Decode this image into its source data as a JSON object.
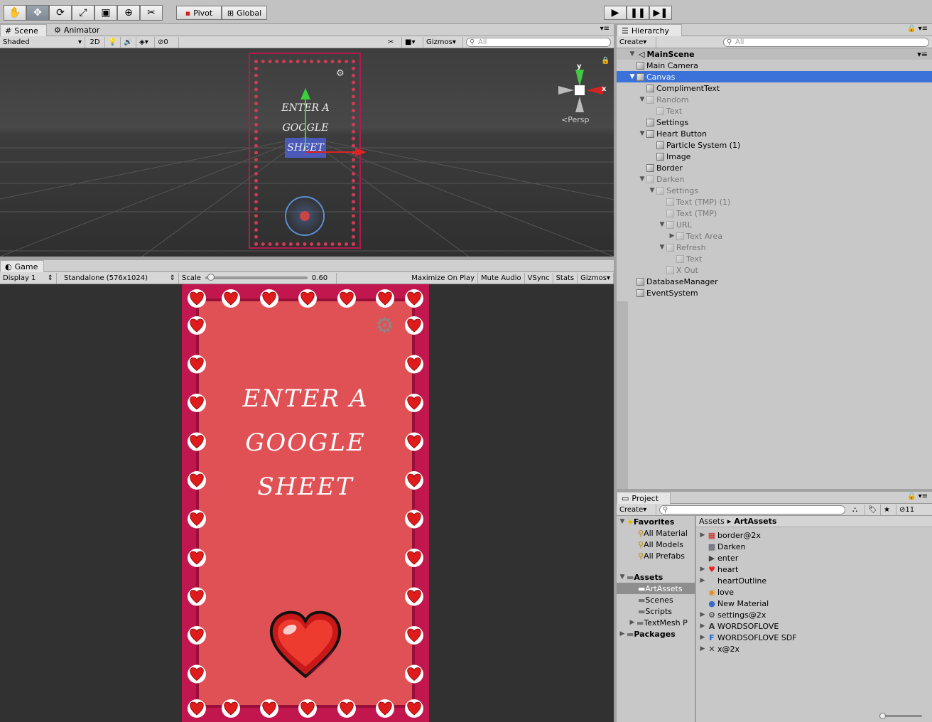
{
  "toolbar": {
    "tools": [
      "hand-tool-icon",
      "move-tool-icon",
      "rotate-tool-icon",
      "scale-tool-icon",
      "rect-tool-icon",
      "transform-tool-icon",
      "custom-tool-icon"
    ],
    "pivot": "Pivot",
    "global": "Global"
  },
  "scene": {
    "tab": "Scene",
    "animator_tab": "Animator",
    "shading": "Shaded",
    "mode_2d": "2D",
    "fx_count": "0",
    "gizmos": "Gizmos",
    "search_placeholder": "All",
    "persp": "Persp",
    "axis_y": "y",
    "axis_x": "x"
  },
  "game": {
    "tab": "Game",
    "display": "Display 1",
    "resolution": "Standalone (576x1024)",
    "scale_label": "Scale",
    "scale_value": "0.60",
    "scale_fraction": 0.02,
    "toggles": [
      "Maximize On Play",
      "Mute Audio",
      "VSync",
      "Stats",
      "Gizmos"
    ],
    "title_lines": [
      "ENTER A",
      "GOOGLE",
      "SHEET"
    ],
    "bg_color": "#df5155",
    "border_color": "#c1174e"
  },
  "hierarchy": {
    "tab": "Hierarchy",
    "create": "Create",
    "search_placeholder": "All",
    "scene": "MainScene",
    "items": [
      {
        "label": "Main Camera",
        "depth": 1,
        "arrow": "",
        "dim": false,
        "sel": false
      },
      {
        "label": "Canvas",
        "depth": 1,
        "arrow": "down",
        "dim": false,
        "sel": true
      },
      {
        "label": "ComplimentText",
        "depth": 2,
        "arrow": "",
        "dim": false,
        "sel": false
      },
      {
        "label": "Random",
        "depth": 2,
        "arrow": "down",
        "dim": true,
        "sel": false
      },
      {
        "label": "Text",
        "depth": 3,
        "arrow": "",
        "dim": true,
        "sel": false
      },
      {
        "label": "Settings",
        "depth": 2,
        "arrow": "",
        "dim": false,
        "sel": false
      },
      {
        "label": "Heart Button",
        "depth": 2,
        "arrow": "down",
        "dim": false,
        "sel": false
      },
      {
        "label": "Particle System (1)",
        "depth": 3,
        "arrow": "",
        "dim": false,
        "sel": false
      },
      {
        "label": "Image",
        "depth": 3,
        "arrow": "",
        "dim": false,
        "sel": false
      },
      {
        "label": "Border",
        "depth": 2,
        "arrow": "",
        "dim": false,
        "sel": false
      },
      {
        "label": "Darken",
        "depth": 2,
        "arrow": "down",
        "dim": true,
        "sel": false
      },
      {
        "label": "Settings",
        "depth": 3,
        "arrow": "down",
        "dim": true,
        "sel": false
      },
      {
        "label": "Text (TMP) (1)",
        "depth": 4,
        "arrow": "",
        "dim": true,
        "sel": false
      },
      {
        "label": "Text (TMP)",
        "depth": 4,
        "arrow": "",
        "dim": true,
        "sel": false
      },
      {
        "label": "URL",
        "depth": 4,
        "arrow": "down",
        "dim": true,
        "sel": false
      },
      {
        "label": "Text Area",
        "depth": 5,
        "arrow": "right",
        "dim": true,
        "sel": false
      },
      {
        "label": "Refresh",
        "depth": 4,
        "arrow": "down",
        "dim": true,
        "sel": false
      },
      {
        "label": "Text",
        "depth": 5,
        "arrow": "",
        "dim": true,
        "sel": false
      },
      {
        "label": "X Out",
        "depth": 4,
        "arrow": "",
        "dim": true,
        "sel": false
      },
      {
        "label": "DatabaseManager",
        "depth": 1,
        "arrow": "",
        "dim": false,
        "sel": false
      },
      {
        "label": "EventSystem",
        "depth": 1,
        "arrow": "",
        "dim": false,
        "sel": false
      }
    ]
  },
  "project": {
    "tab": "Project",
    "create": "Create",
    "count": "11",
    "favorites": {
      "label": "Favorites",
      "items": [
        "All Material",
        "All Models",
        "All Prefabs"
      ]
    },
    "assets": {
      "label": "Assets",
      "folders": [
        {
          "label": "ArtAssets",
          "sel": true
        },
        {
          "label": "Scenes",
          "sel": false
        },
        {
          "label": "Scripts",
          "sel": false
        },
        {
          "label": "TextMesh P",
          "sel": false
        }
      ]
    },
    "packages": "Packages",
    "breadcrumb_root": "Assets",
    "breadcrumb_current": "ArtAssets",
    "files": [
      {
        "label": "border@2x",
        "icon": "border-icon",
        "arrow": true
      },
      {
        "label": "Darken",
        "icon": "sprite-icon",
        "arrow": false
      },
      {
        "label": "enter",
        "icon": "animation-icon",
        "arrow": false
      },
      {
        "label": "heart",
        "icon": "heart-icon",
        "arrow": true
      },
      {
        "label": "heartOutline",
        "icon": "heart-outline-icon",
        "arrow": true
      },
      {
        "label": "love",
        "icon": "audio-icon",
        "arrow": false
      },
      {
        "label": "New Material",
        "icon": "material-icon",
        "arrow": false
      },
      {
        "label": "settings@2x",
        "icon": "settings-icon",
        "arrow": true
      },
      {
        "label": "WORDSOFLOVE",
        "icon": "font-icon",
        "arrow": true
      },
      {
        "label": "WORDSOFLOVE SDF",
        "icon": "sdf-font-icon",
        "arrow": true
      },
      {
        "label": "x@2x",
        "icon": "x-icon",
        "arrow": true
      }
    ]
  }
}
